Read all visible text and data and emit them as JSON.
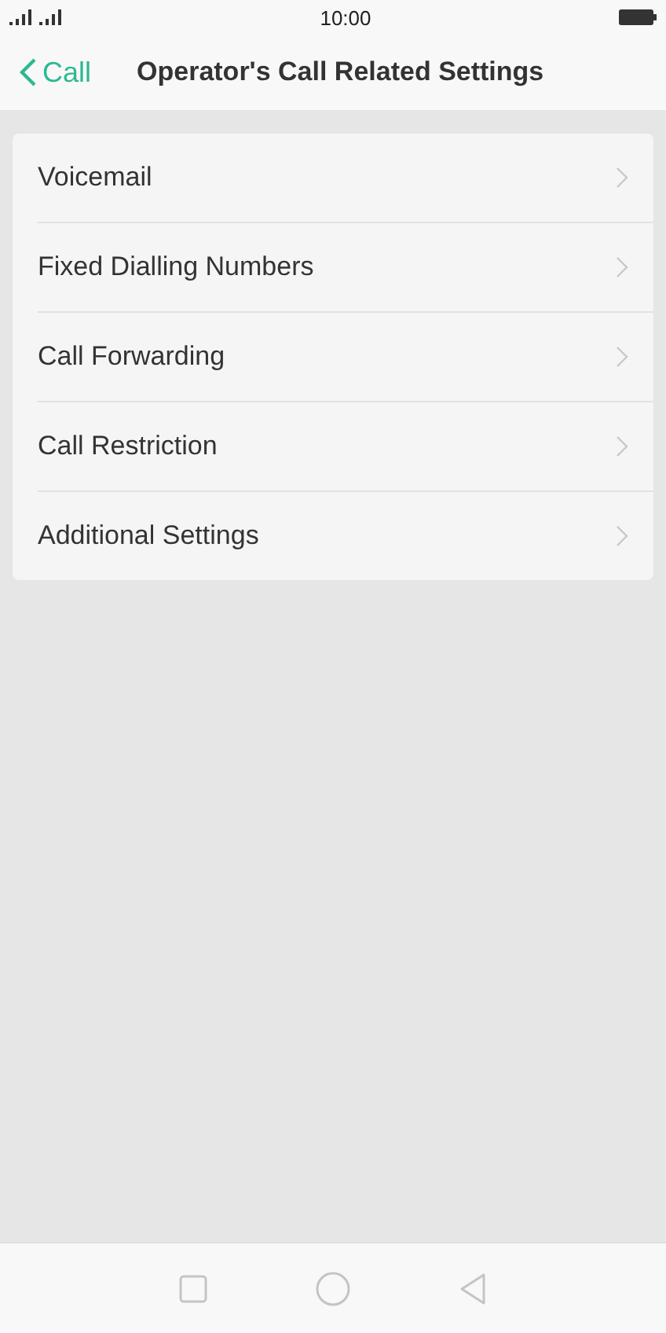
{
  "status_bar": {
    "time": "10:00"
  },
  "header": {
    "back_label": "Call",
    "title": "Operator's Call Related Settings"
  },
  "items": [
    {
      "label": "Voicemail"
    },
    {
      "label": "Fixed Dialling Numbers"
    },
    {
      "label": "Call Forwarding"
    },
    {
      "label": "Call Restriction"
    },
    {
      "label": "Additional Settings"
    }
  ]
}
